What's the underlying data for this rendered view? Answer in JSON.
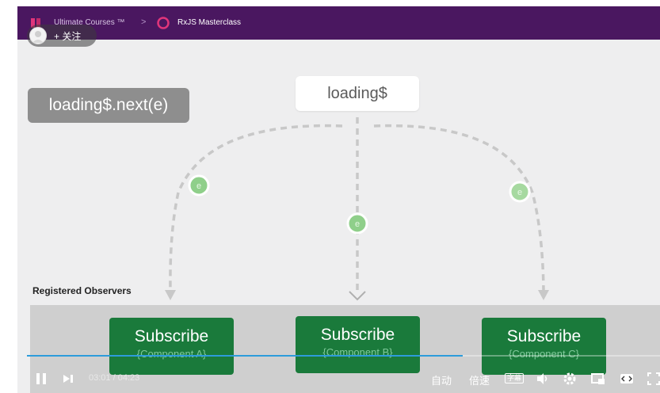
{
  "header": {
    "brand": "Ultimate Courses ™",
    "separator": ">",
    "course": "RxJS Masterclass"
  },
  "follow": {
    "label": "+ 关注"
  },
  "diagram": {
    "emit_label": "loading$.next(e)",
    "source_label": "loading$",
    "event_token": "e",
    "observers_heading": "Registered Observers",
    "subscribers": [
      {
        "title": "Subscribe",
        "component": "{Component A}"
      },
      {
        "title": "Subscribe",
        "component": "{Component B}"
      },
      {
        "title": "Subscribe",
        "component": "{Component C}"
      }
    ]
  },
  "player": {
    "current_time": "03:01",
    "time_sep": "/",
    "duration": "04:23",
    "progress_fraction": 0.688,
    "auto_label": "自动",
    "speed_label": "倍速",
    "subtitle_label": "字幕",
    "icons": [
      "pause-icon",
      "next-icon",
      "volume-icon",
      "settings-icon",
      "pip-icon",
      "widescreen-icon",
      "fullscreen-icon"
    ]
  },
  "colors": {
    "topbar": "#4a1760",
    "subscribe_green": "#1a7a3b",
    "event_green": "#8fcf8a",
    "progress_blue": "#2d9cdb"
  }
}
